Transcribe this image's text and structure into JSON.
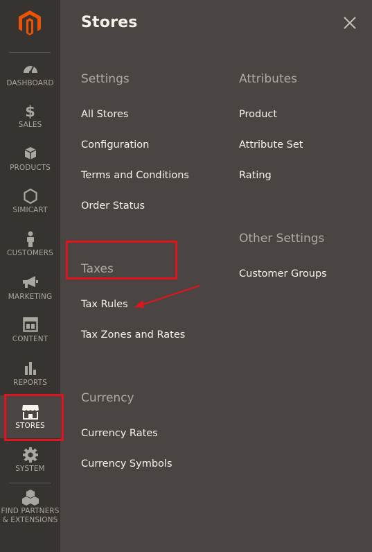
{
  "sidebar": {
    "items": [
      {
        "label": "DASHBOARD",
        "icon": "dashboard-icon"
      },
      {
        "label": "$",
        "sub": "SALES",
        "icon": "dollar-icon"
      },
      {
        "label": "PRODUCTS",
        "icon": "products-box-icon"
      },
      {
        "label": "SIMICART",
        "icon": "hexagon-icon"
      },
      {
        "label": "CUSTOMERS",
        "icon": "customer-person-icon"
      },
      {
        "label": "MARKETING",
        "icon": "megaphone-icon"
      },
      {
        "label": "CONTENT",
        "icon": "content-layout-icon"
      },
      {
        "label": "REPORTS",
        "icon": "bar-chart-icon"
      },
      {
        "label": "STORES",
        "icon": "store-awning-icon"
      },
      {
        "label": "SYSTEM",
        "icon": "gear-icon"
      },
      {
        "label": "FIND PARTNERS",
        "label2": "& EXTENSIONS",
        "icon": "cubes-icon"
      }
    ],
    "active": "STORES"
  },
  "panel": {
    "title": "Stores",
    "close_icon": "close-icon",
    "settings": {
      "title": "Settings",
      "links": [
        "All Stores",
        "Configuration",
        "Terms and Conditions",
        "Order Status"
      ]
    },
    "taxes": {
      "title": "Taxes",
      "links": [
        "Tax Rules",
        "Tax Zones and Rates"
      ]
    },
    "currency": {
      "title": "Currency",
      "links": [
        "Currency Rates",
        "Currency Symbols"
      ]
    },
    "attributes": {
      "title": "Attributes",
      "links": [
        "Product",
        "Attribute Set",
        "Rating"
      ]
    },
    "other_settings": {
      "title": "Other Settings",
      "links": [
        "Customer Groups"
      ]
    }
  },
  "colors": {
    "sidebar_bg": "#373330",
    "panel_bg": "#4a4542",
    "brand_orange": "#eb5202",
    "highlight_red": "#e0141e"
  }
}
